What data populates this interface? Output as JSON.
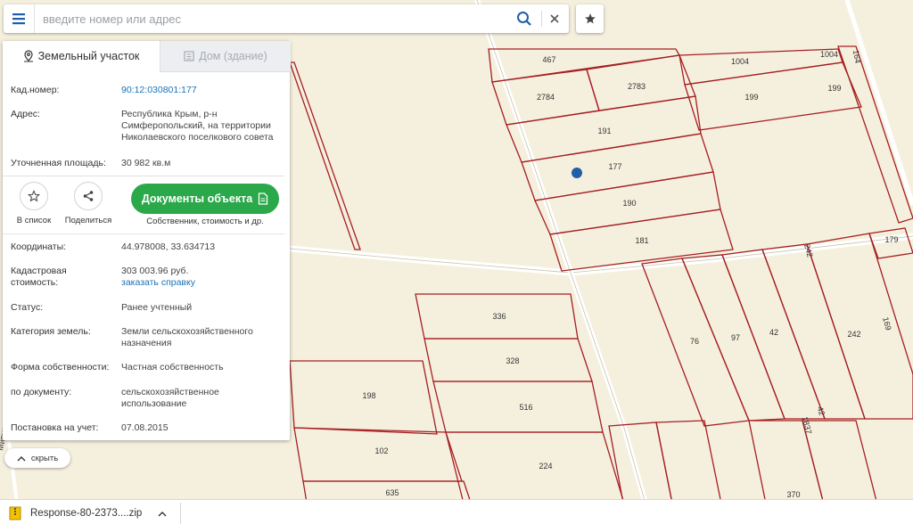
{
  "search": {
    "placeholder": "введите номер или адрес"
  },
  "panel": {
    "tabs": [
      {
        "label": "Земельный участок"
      },
      {
        "label": "Дом (здание)"
      }
    ],
    "fields": {
      "cad_number": {
        "label": "Кад.номер:",
        "value": "90:12:030801:177"
      },
      "address": {
        "label": "Адрес:",
        "value": "Республика Крым, р-н Симферопольский, на территории Николаевского поселкового совета"
      },
      "area": {
        "label": "Уточненная площадь:",
        "value": "30 982 кв.м"
      },
      "coords": {
        "label": "Координаты:",
        "value": "44.978008, 33.634713"
      },
      "cad_cost": {
        "label": "Кадастровая стоимость:",
        "value": "303 003.96 руб.",
        "link": "заказать справку"
      },
      "status": {
        "label": "Статус:",
        "value": "Ранее учтенный"
      },
      "category": {
        "label": "Категория земель:",
        "value": "Земли сельскохозяйственного назначения"
      },
      "ownership": {
        "label": "Форма собственности:",
        "value": "Частная собственность"
      },
      "by_doc": {
        "label": "по документу:",
        "value": "сельскохозяйственное использование"
      },
      "registered": {
        "label": "Постановка на учет:",
        "value": "07.08.2015"
      }
    },
    "actions": {
      "to_list": "В список",
      "share": "Поделиться",
      "docs_button": "Документы объекта",
      "docs_sub": "Собственник, стоимость и др."
    }
  },
  "hide_label": "скрыть",
  "download": {
    "filename": "Response-80-2373....zip"
  },
  "map": {
    "plot_labels": [
      "467",
      "1004",
      "1004",
      "164",
      "2784",
      "2783",
      "199",
      "199",
      "191",
      "177",
      "190",
      "181",
      "179",
      "242",
      "242",
      "169",
      "336",
      "328",
      "516",
      "76",
      "97",
      "42",
      "42",
      "198",
      "102",
      "224",
      "635",
      "1837",
      "370"
    ],
    "road_label": "Мирное"
  },
  "colors": {
    "plot_border": "#a61e22",
    "marker": "#1f5fa8",
    "accent_green": "#2aa84a",
    "link": "#1a73b8"
  }
}
